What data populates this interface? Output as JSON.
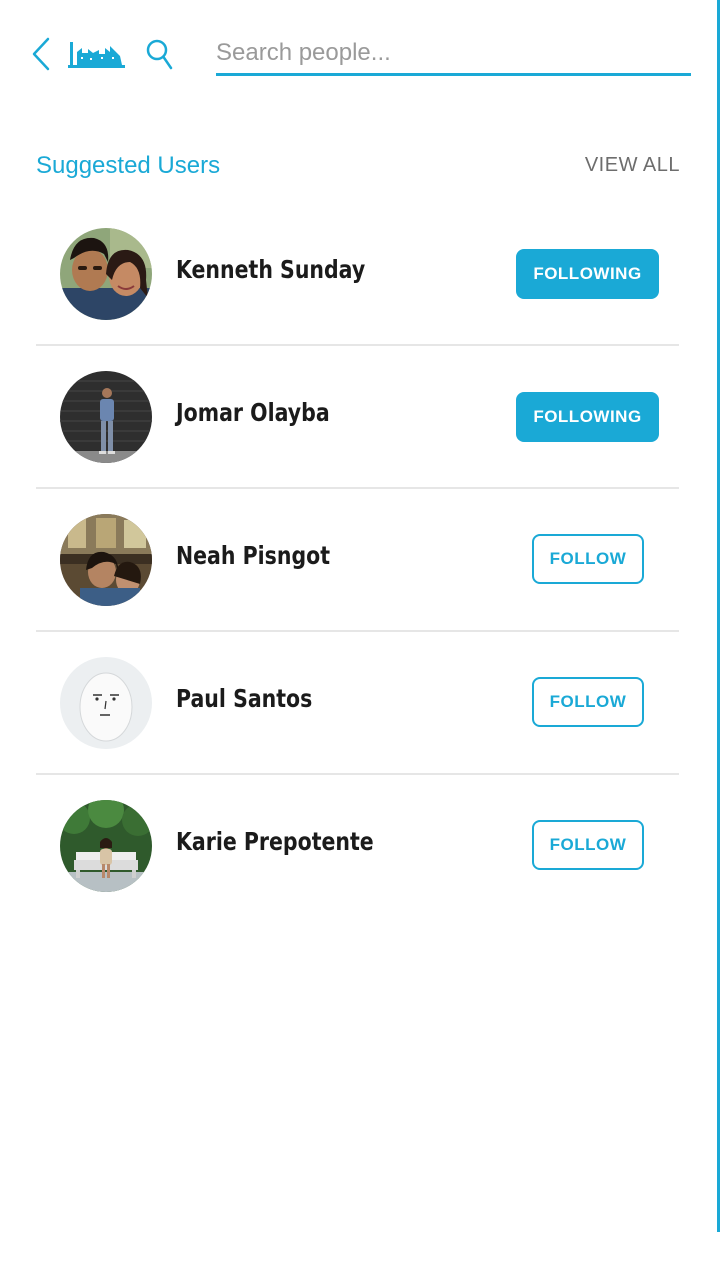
{
  "colors": {
    "accent": "#1aa9d6",
    "divider": "#e6e6e6",
    "muted_text": "#6d6d6d",
    "name_text": "#1b1b1b"
  },
  "topbar": {
    "back_icon": "chevron-left-icon",
    "logo_icon": "city-skyline-logo",
    "search_icon": "search-icon",
    "search_placeholder": "Search people...",
    "search_value": ""
  },
  "suggested": {
    "title": "Suggested Users",
    "view_all_label": "VIEW ALL",
    "users": [
      {
        "name": "Kenneth Sunday",
        "button": "FOLLOWING",
        "following": true,
        "avatar": "couple-selfie-photo"
      },
      {
        "name": "Jomar Olayba",
        "button": "FOLLOWING",
        "following": true,
        "avatar": "man-standing-dark-wall-photo"
      },
      {
        "name": "Neah Pisngot",
        "button": "FOLLOW",
        "following": false,
        "avatar": "cafe-selfie-photo"
      },
      {
        "name": "Paul Santos",
        "button": "FOLLOW",
        "following": false,
        "avatar": "egg-face-photo"
      },
      {
        "name": "Karie Prepotente",
        "button": "FOLLOW",
        "following": false,
        "avatar": "garden-bench-photo"
      }
    ]
  }
}
